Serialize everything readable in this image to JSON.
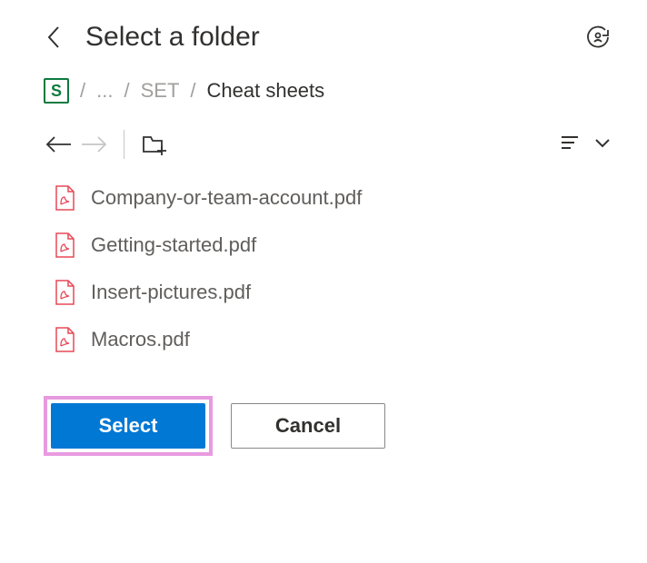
{
  "header": {
    "title": "Select a folder"
  },
  "breadcrumb": {
    "app_letter": "S",
    "ellipsis": "...",
    "parent": "SET",
    "current": "Cheat sheets"
  },
  "files": [
    {
      "name": "Company-or-team-account.pdf"
    },
    {
      "name": "Getting-started.pdf"
    },
    {
      "name": "Insert-pictures.pdf"
    },
    {
      "name": "Macros.pdf"
    }
  ],
  "footer": {
    "select_label": "Select",
    "cancel_label": "Cancel"
  }
}
